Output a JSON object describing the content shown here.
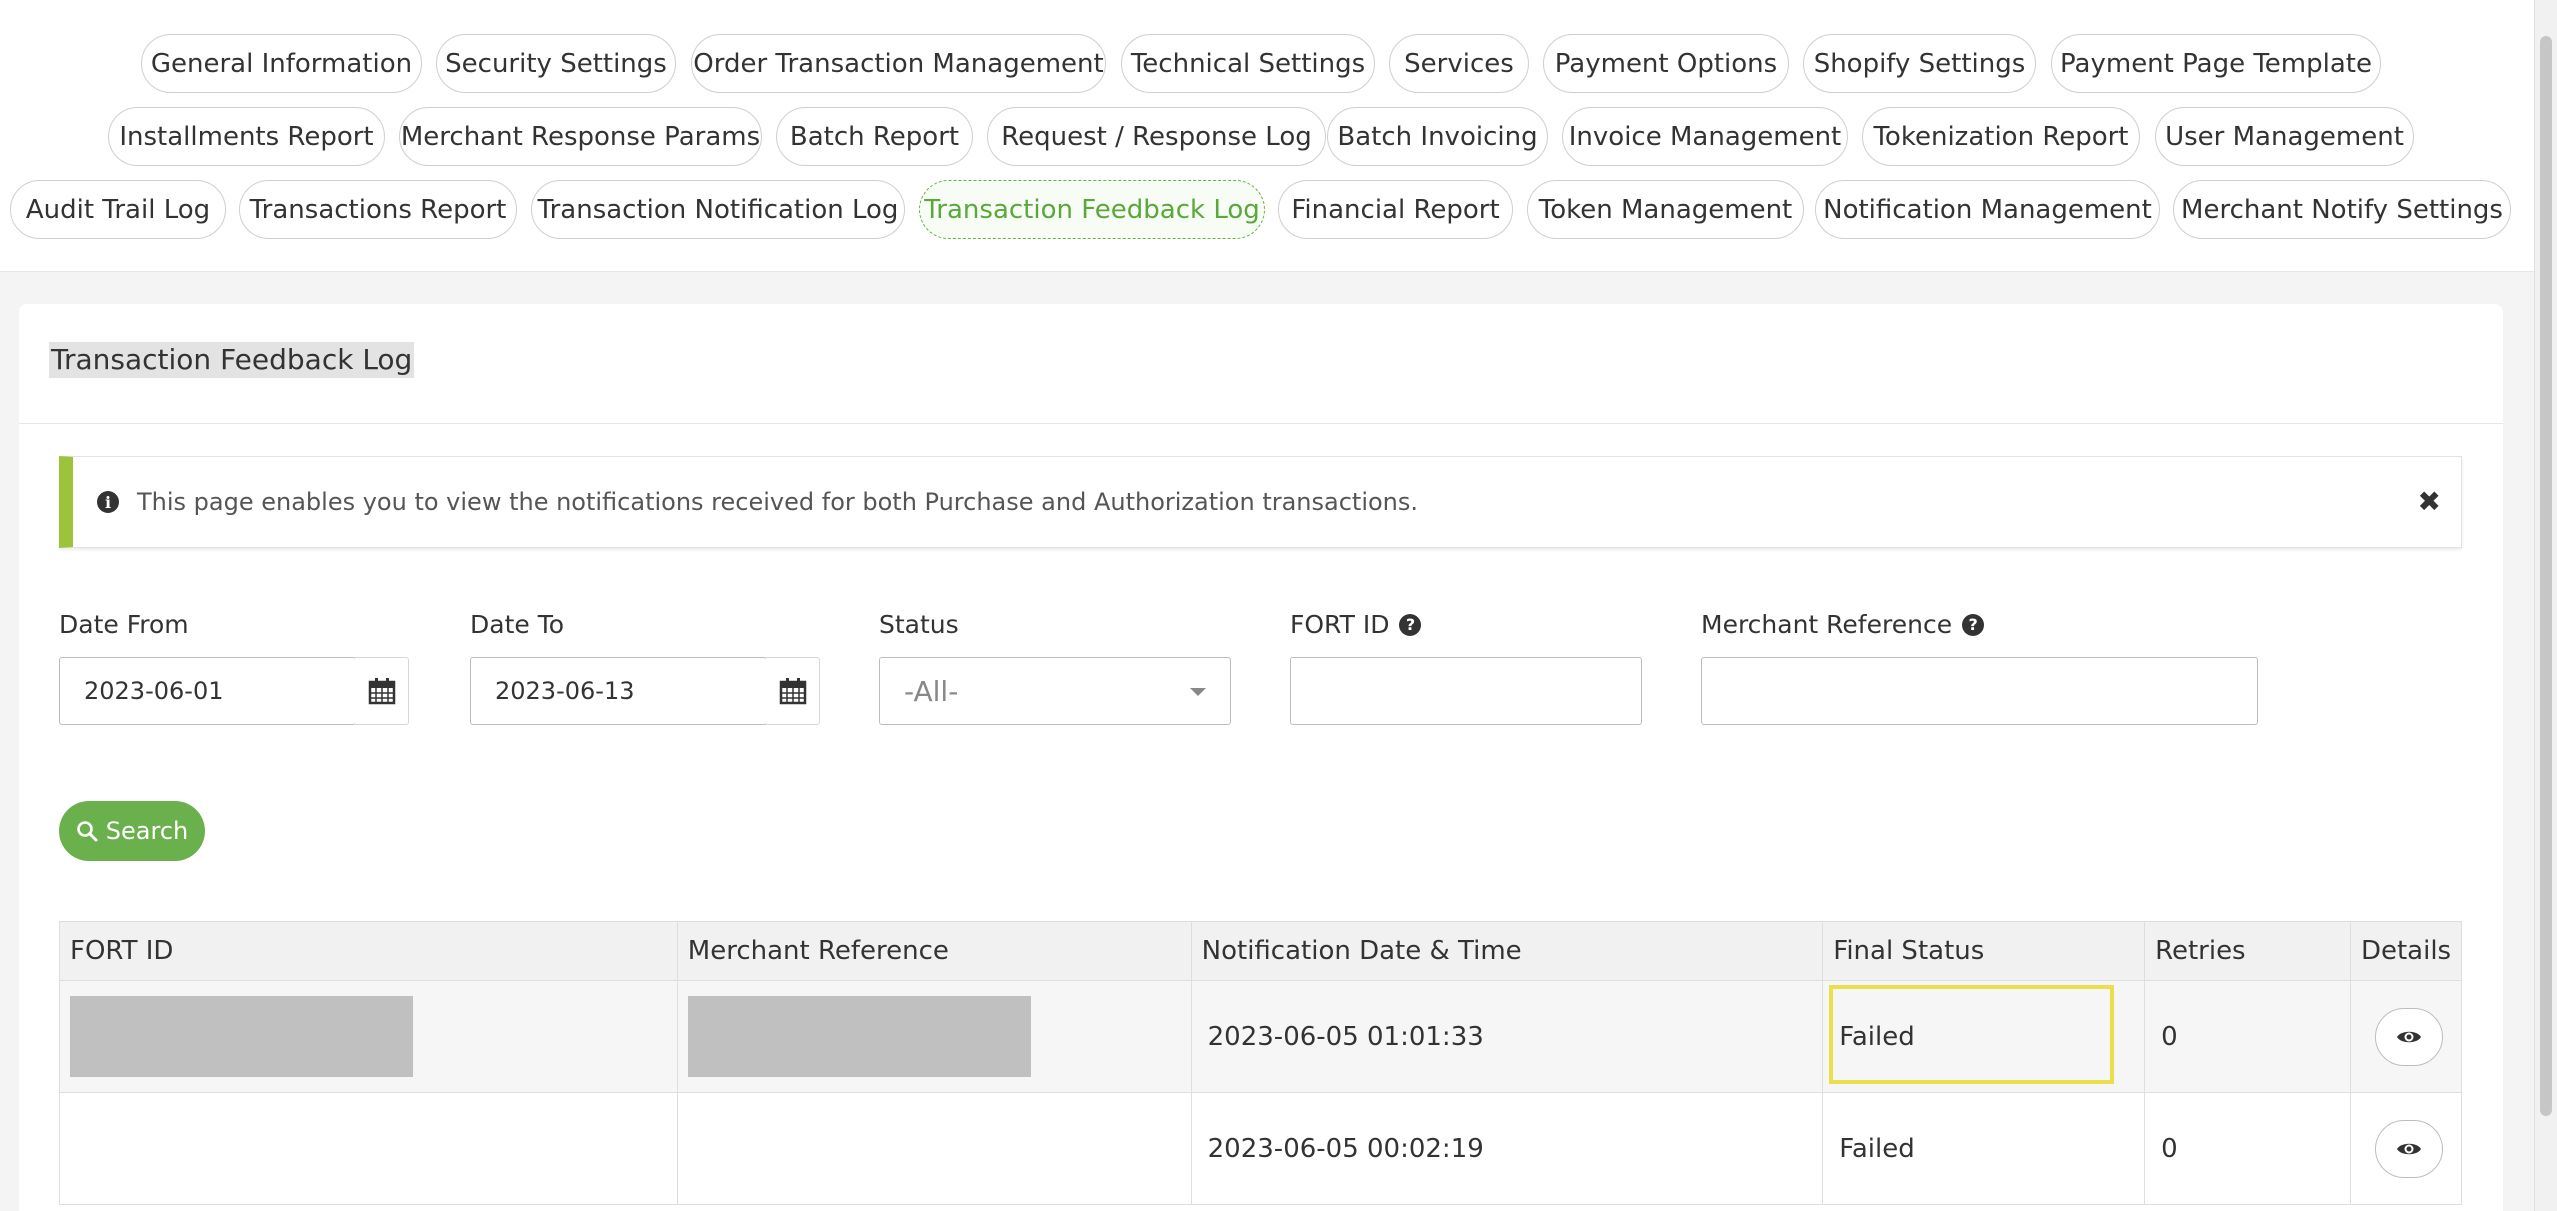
{
  "tabs": [
    {
      "label": "General Information"
    },
    {
      "label": "Security Settings"
    },
    {
      "label": "Order Transaction Management"
    },
    {
      "label": "Technical Settings"
    },
    {
      "label": "Services"
    },
    {
      "label": "Payment Options"
    },
    {
      "label": "Shopify Settings"
    },
    {
      "label": "Payment Page Template"
    },
    {
      "label": "Installments Report"
    },
    {
      "label": "Merchant Response Params"
    },
    {
      "label": "Batch Report"
    },
    {
      "label": "Request / Response Log"
    },
    {
      "label": "Batch Invoicing"
    },
    {
      "label": "Invoice Management"
    },
    {
      "label": "Tokenization Report"
    },
    {
      "label": "User Management"
    },
    {
      "label": "Audit Trail Log"
    },
    {
      "label": "Transactions Report"
    },
    {
      "label": "Transaction Notification Log"
    },
    {
      "label": "Transaction Feedback Log",
      "active": true
    },
    {
      "label": "Financial Report"
    },
    {
      "label": "Token Management"
    },
    {
      "label": "Notification Management"
    },
    {
      "label": "Merchant Notify Settings"
    }
  ],
  "panel": {
    "title": "Transaction Feedback Log",
    "alert_text": "This page enables you to view the notifications received for both Purchase and Authorization transactions.",
    "alert_close": "✖"
  },
  "filters": {
    "date_from_label": "Date From",
    "date_from_value": "2023-06-01",
    "date_to_label": "Date To",
    "date_to_value": "2023-06-13",
    "status_label": "Status",
    "status_value": "-All-",
    "fort_id_label": "FORT ID",
    "fort_id_value": "",
    "merchant_ref_label": "Merchant Reference",
    "merchant_ref_value": "",
    "search_label": "Search"
  },
  "table": {
    "headers": {
      "fort_id": "FORT ID",
      "merchant_ref": "Merchant Reference",
      "notif_datetime": "Notification Date & Time",
      "final_status": "Final Status",
      "retries": "Retries",
      "details": "Details"
    },
    "rows": [
      {
        "notif_datetime": "2023-06-05 01:01:33",
        "final_status": "Failed",
        "retries": "0"
      },
      {
        "notif_datetime": "2023-06-05 00:02:19",
        "final_status": "Failed",
        "retries": "0"
      }
    ]
  },
  "colors": {
    "accent_green": "#6ab04c",
    "alert_bar": "#9dc33a",
    "highlight_yellow": "#ecdf4e"
  }
}
